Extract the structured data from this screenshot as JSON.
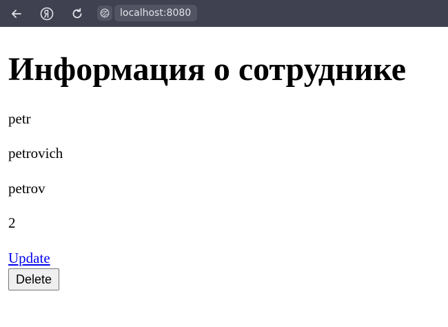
{
  "browser": {
    "url": "localhost:8080"
  },
  "page": {
    "title": "Информация о сотруднике",
    "employee": {
      "first_name": "petr",
      "patronymic": "petrovich",
      "last_name": "petrov",
      "number": "2"
    },
    "update_link": "Update",
    "delete_button": "Delete"
  },
  "colors": {
    "toolbar": "#3f4150",
    "link": "#0000ee"
  },
  "icons": [
    "back-arrow-icon",
    "yandex-icon",
    "reload-icon",
    "site-info-icon"
  ]
}
